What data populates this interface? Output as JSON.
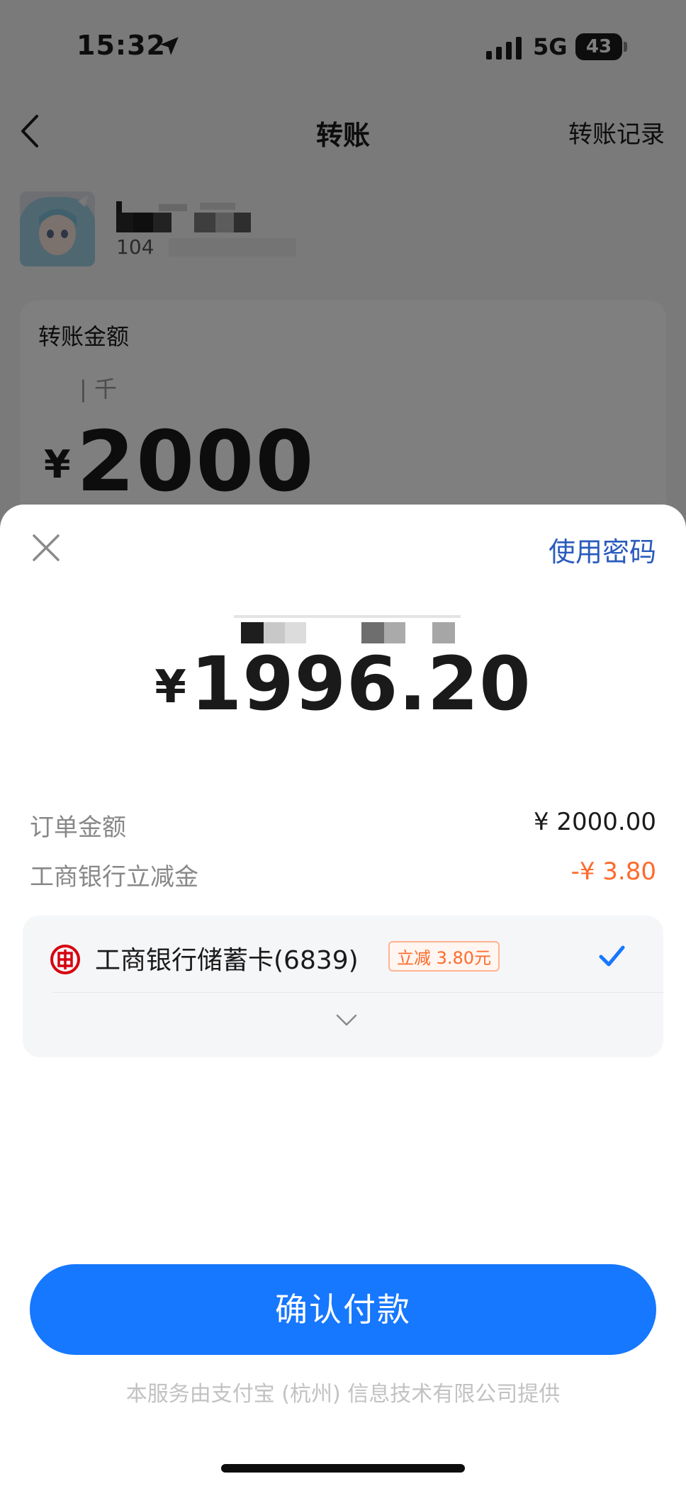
{
  "status_bar": {
    "time": "15:32",
    "network": "5G",
    "battery": "43"
  },
  "nav": {
    "title": "转账",
    "history_link": "转账记录"
  },
  "payee": {
    "account_prefix": "104"
  },
  "amount_card": {
    "label": "转账金额",
    "unit_hint": "千",
    "currency_symbol": "¥",
    "amount": "2000"
  },
  "sheet": {
    "use_password": "使用密码",
    "pay_currency": "¥",
    "pay_amount": "1996.20",
    "order_amount_label": "订单金额",
    "order_amount_value": "¥ 2000.00",
    "discount_label": "工商银行立减金",
    "discount_value": "-¥ 3.80",
    "payment_method": {
      "bank_name": "工商银行储蓄卡(6839)",
      "promo_tag": "立减 3.80元",
      "selected": true
    },
    "confirm_button": "确认付款",
    "footer_note": "本服务由支付宝 (杭州) 信息技术有限公司提供"
  },
  "colors": {
    "primary": "#1677ff",
    "link": "#2a5bbd",
    "discount": "#ff6a2b",
    "icbc_red": "#d7000f"
  },
  "icons": [
    "location-arrow-icon",
    "signal-icon",
    "battery-icon",
    "back-icon",
    "close-icon",
    "icbc-logo-icon",
    "check-icon",
    "chevron-down-icon"
  ]
}
